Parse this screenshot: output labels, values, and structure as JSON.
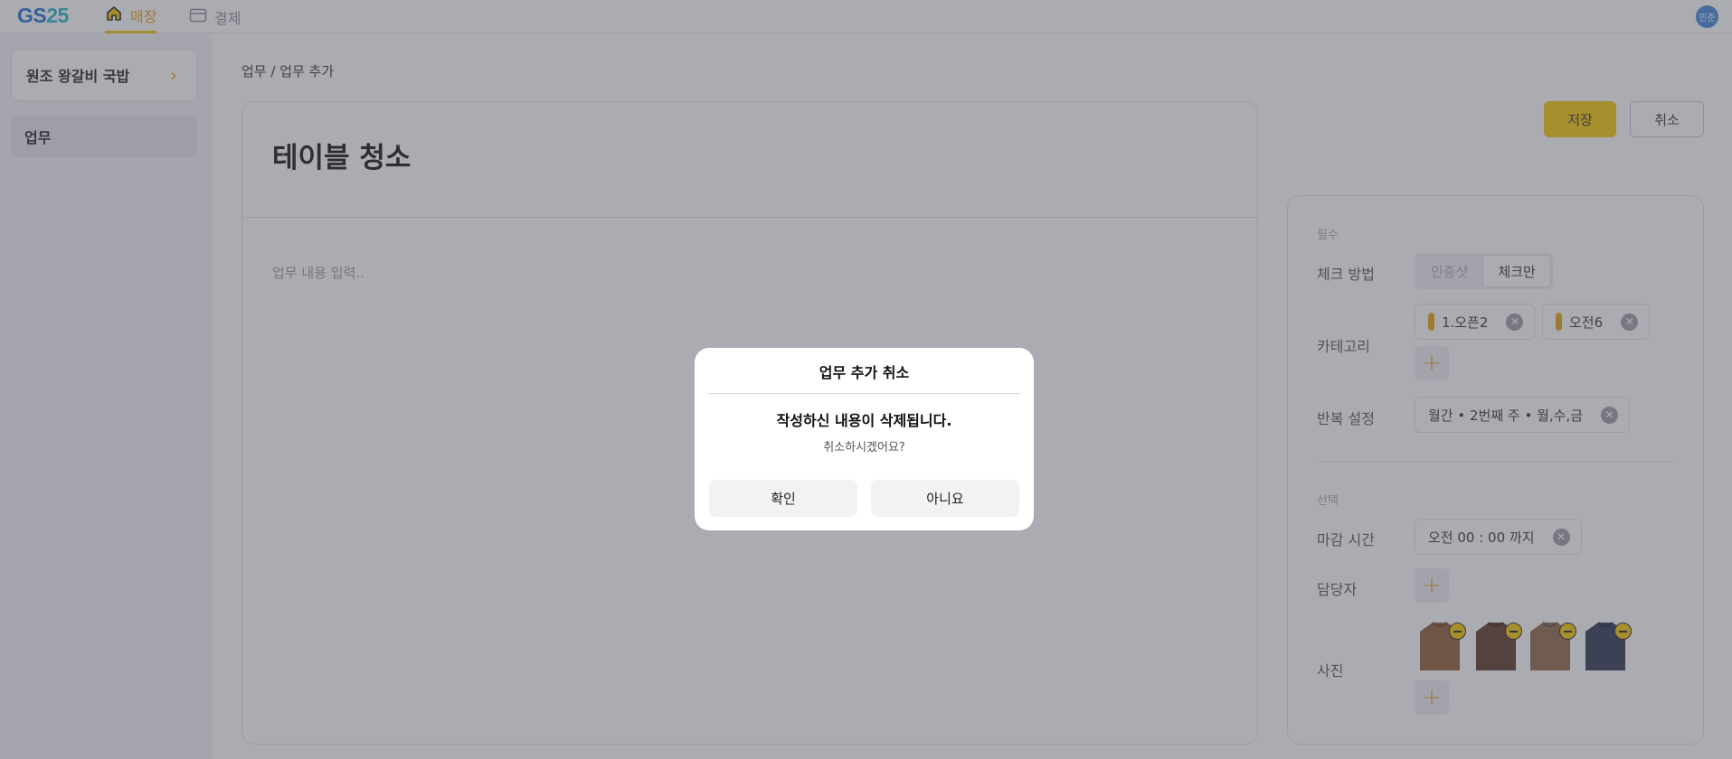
{
  "header": {
    "logo_gs": "GS",
    "logo_num": "25",
    "tabs": [
      {
        "label": "매장",
        "icon": "home-icon",
        "active": true
      },
      {
        "label": "결제",
        "icon": "card-icon",
        "active": false
      }
    ],
    "avatar_text": "민준"
  },
  "sidebar": {
    "store_name": "원조 왕갈비 국밥",
    "items": [
      {
        "label": "업무",
        "selected": true
      }
    ]
  },
  "breadcrumb": "업무 / 업무 추가",
  "editor": {
    "title": "테이블 청소",
    "body_placeholder": "업무 내용 입력.."
  },
  "actions": {
    "save_label": "저장",
    "cancel_label": "취소"
  },
  "properties": {
    "required_section": "필수",
    "check_method": {
      "label": "체크 방법",
      "options": [
        "인증샷",
        "체크만"
      ],
      "selected": "체크만"
    },
    "category": {
      "label": "카테고리",
      "chips": [
        "1.오픈2",
        "오전6"
      ]
    },
    "repeat": {
      "label": "반복 설정",
      "value": "월간 • 2번째 주 • 월,수,금"
    },
    "optional_section": "선택",
    "deadline": {
      "label": "마감 시간",
      "value": "오전 00 : 00 까지"
    },
    "assignee": {
      "label": "담당자"
    },
    "photos": {
      "label": "사진",
      "items": [
        {
          "color": "#8a5a30"
        },
        {
          "color": "#5a3522"
        },
        {
          "color": "#8c6644"
        },
        {
          "color": "#2c3450"
        }
      ]
    }
  },
  "dialog": {
    "title": "업무 추가 취소",
    "message": "작성하신 내용이 삭제됩니다.",
    "sub": "취소하시겠어요?",
    "confirm_label": "확인",
    "deny_label": "아니요"
  },
  "colors": {
    "accent": "#f5c900",
    "accent_text": "#e3a50b",
    "overlay": "rgba(80,80,95,0.48)"
  }
}
